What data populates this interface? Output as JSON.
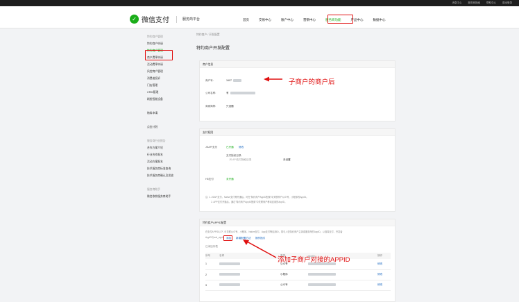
{
  "topbar": [
    "消息中心",
    "服务商指南",
    "帮助中心",
    "退出登录"
  ],
  "header": {
    "logo": "微信支付",
    "sub": "服务商平台",
    "nav": [
      "首页",
      "交易中心",
      "账户中心",
      "营销中心",
      "服务商功能",
      "产品中心",
      "数据中心"
    ]
  },
  "sidebar": [
    {
      "t": "特约商户管理",
      "g": true
    },
    {
      "t": "特约商户申请"
    },
    {
      "t": "特约商户管理",
      "a": true
    },
    {
      "t": "商户费率申请"
    },
    {
      "t": "活动费率申请"
    },
    {
      "t": "风控商户管理"
    },
    {
      "t": "消费者投诉"
    },
    {
      "t": "门店管理"
    },
    {
      "t": "CRM管理"
    },
    {
      "t": "刷脸智能设备"
    },
    {
      "t": ""
    },
    {
      "t": "物料申请"
    },
    {
      "t": ""
    },
    {
      "t": "点金计划"
    },
    {
      "t": ""
    },
    {
      "t": "服务商行业报告",
      "g": true
    },
    {
      "t": "合作方案介绍"
    },
    {
      "t": "行业合作报名"
    },
    {
      "t": "活动方案报名"
    },
    {
      "t": "技术服务商标准查询"
    },
    {
      "t": "技术服务商确认及发放"
    },
    {
      "t": ""
    },
    {
      "t": "服务商助手",
      "g": true
    },
    {
      "t": "微信收款服务商助手"
    }
  ],
  "crumb": "特约商户 / 开发配置",
  "title": "特约商户开发配置",
  "s1": {
    "h": "商户信息",
    "l1": "商户号:",
    "v1": "1607",
    "l2": "公司名称:",
    "v2": "有",
    "l3": "商家简称:",
    "v3": "只选题"
  },
  "ann1": "子商户的商户后",
  "s2": {
    "h": "支付权限",
    "l1": "JSAPI支付",
    "v1a": "已开通",
    "v1b": "修改",
    "l2": "支付授权目录:",
    "sub": "JS API支付授权目录",
    "v2": "未设置",
    "l3": "H5支付",
    "v3": "未开通",
    "n1": "注: 1. JSAPI支付、Native支付等开通后，可在\"特约商户AppID配置\"中关联商户公众号、小程序的AppID。",
    "n2": "2. APP支付开通后，通过\"特约商户AppID配置\"中关联商户移动应用的AppID。"
  },
  "s3": {
    "h": "特约商户APPID配置",
    "d1": "在支付APPID以下, 可关联公众号、小程序、Native支付、App支付等应用ID，需与入驻特约商户主体或服务商的AppID。以选择支付、开发者",
    "d2": "AppID与sub_appid",
    "add": "添加",
    "l1": "新增配置方法",
    "l2": "操作指引",
    "cnt": "已添加列表",
    "cols": [
      "序号",
      "名称",
      "",
      "类型",
      "AppID",
      "",
      "操作"
    ],
    "rows": [
      [
        "1",
        "公众号",
        "修改"
      ],
      [
        "2",
        "小程序",
        "修改"
      ],
      [
        "3",
        "公众号",
        "修改"
      ]
    ]
  },
  "ann2": "添加子商户对接的APPID",
  "colors": {
    "accent": "#1aad19",
    "annot": "#e01010",
    "link": "#1565c0"
  }
}
